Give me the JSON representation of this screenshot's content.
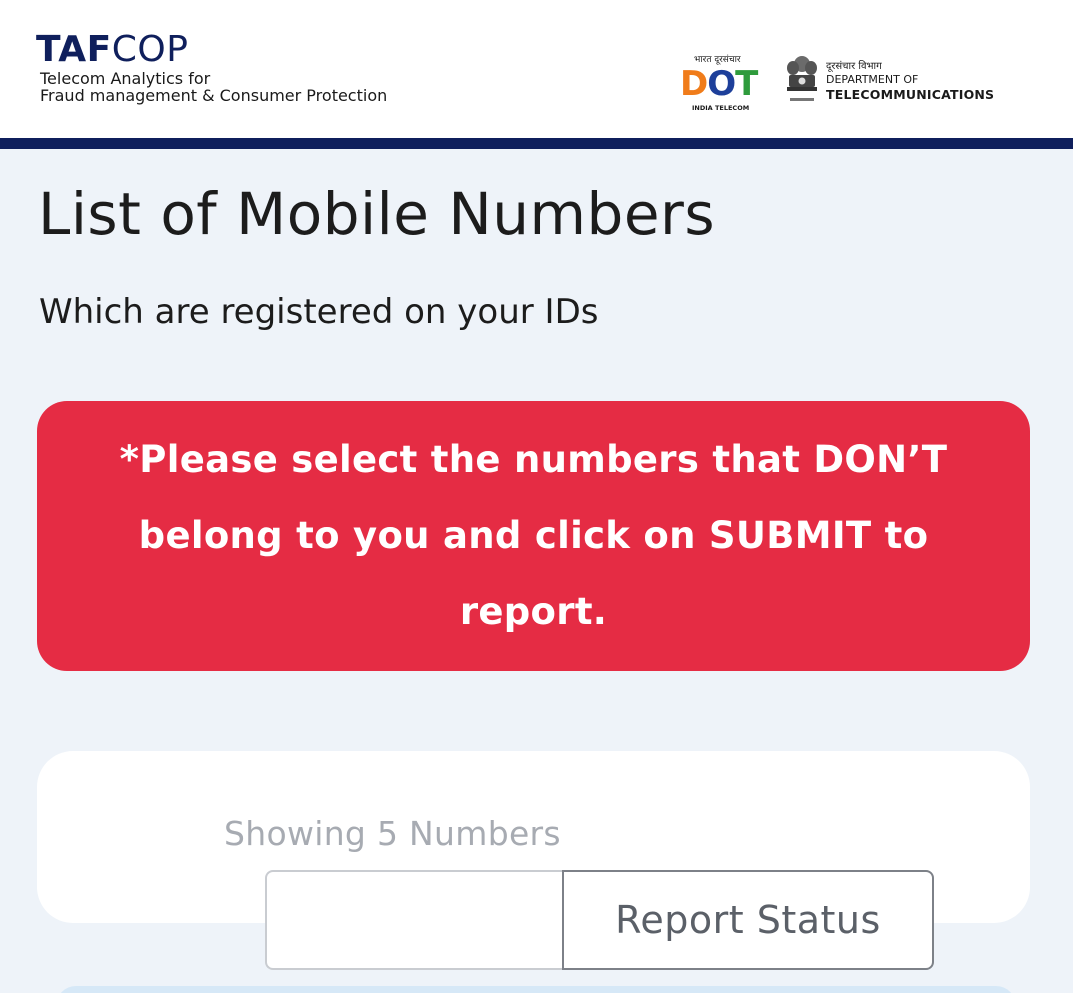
{
  "header": {
    "brand_bold": "TAF",
    "brand_light": "COP",
    "brand_line1": "Telecom Analytics for",
    "brand_line2": "Fraud management & Consumer Protection",
    "dot_hindi": "भारत दूरसंचार",
    "dot_letters": [
      "D",
      "O",
      "T"
    ],
    "dot_tagline": "INDIA TELECOM",
    "dept_hindi": "दूरसंचार विभाग",
    "dept_of": "DEPARTMENT OF",
    "dept_name": "TELECOMMUNICATIONS",
    "bar_color": "#0f1f5c"
  },
  "main": {
    "title": "List of Mobile Numbers",
    "subtitle": "Which are registered on your IDs",
    "alert_text": "*Please select the numbers that DON’T belong to you and click on SUBMIT to report.",
    "alert_color": "#e52c44",
    "showing_text": "Showing 5 Numbers",
    "search_value": "",
    "report_button_label": "Report Status"
  }
}
